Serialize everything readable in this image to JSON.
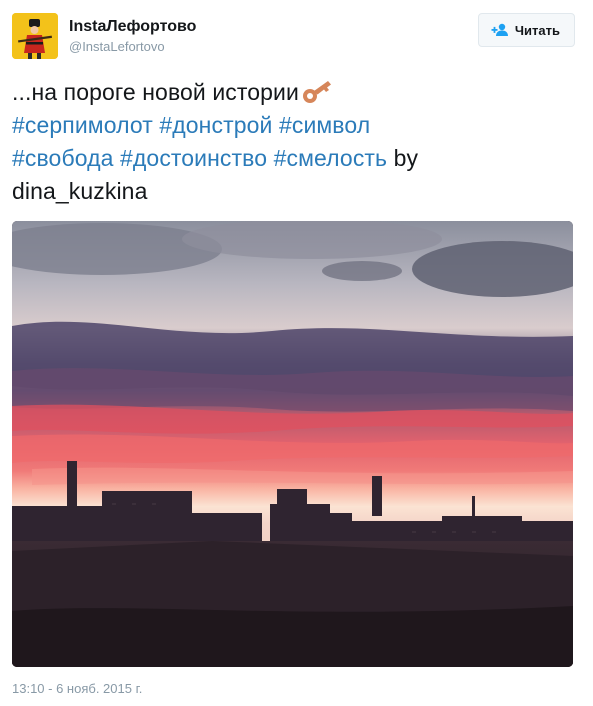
{
  "author": {
    "display_name": "InstaЛефортово",
    "handle": "@InstaLefortovo",
    "avatar_icon": "soldier-icon",
    "avatar_bg": "#f3c21a"
  },
  "follow_button": {
    "label": "Читать",
    "icon": "add-user-icon",
    "icon_color": "#1da1f2"
  },
  "tweet": {
    "text_prefix": "...на пороге новой истории",
    "emoji": "key-icon",
    "hashtags": [
      "#серпимолот",
      "#донстрой",
      "#символ",
      "#свобода",
      "#достоинство",
      "#смелость"
    ],
    "text_suffix_1": "by",
    "text_suffix_2": "dina_kuzkina",
    "hashtag_color": "#2b7bb9"
  },
  "photo": {
    "alt_subject": "sunset-over-city-skyline"
  },
  "timestamp": "13:10 - 6 нояб. 2015 г."
}
